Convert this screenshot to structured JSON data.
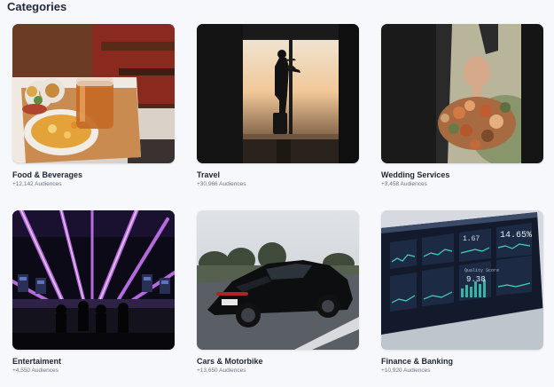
{
  "section": {
    "title": "Categories"
  },
  "categories": [
    {
      "title": "Food & Beverages",
      "audience": "+12,142 Audiences",
      "image_icon": "food-photo"
    },
    {
      "title": "Travel",
      "audience": "+30,966 Audiences",
      "image_icon": "travel-photo"
    },
    {
      "title": "Wedding Services",
      "audience": "+3,458 Audiences",
      "image_icon": "wedding-photo"
    },
    {
      "title": "Entertaiment",
      "audience": "+4,550 Audiences",
      "image_icon": "concert-photo"
    },
    {
      "title": "Cars & Motorbike",
      "audience": "+13,650 Audiences",
      "image_icon": "car-photo"
    },
    {
      "title": "Finance & Banking",
      "audience": "+10,920 Audiences",
      "image_icon": "finance-photo"
    }
  ],
  "finance_screen": {
    "stat_main": "14.65%",
    "stat_small": "1.67",
    "quality_label": "Quality Score",
    "quality_value": "9.38"
  }
}
